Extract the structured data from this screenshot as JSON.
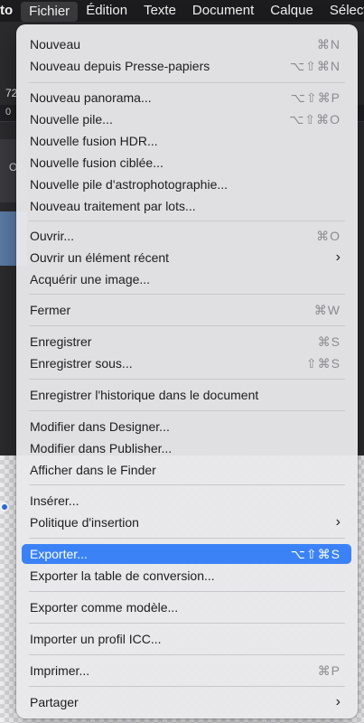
{
  "menubar": {
    "app": "to",
    "items": [
      "Fichier",
      "Édition",
      "Texte",
      "Document",
      "Calque",
      "Sélecti"
    ]
  },
  "background": {
    "toolbar_value": "72",
    "ruler_tick": "0",
    "panel_text": "O"
  },
  "menu": {
    "items": [
      {
        "label": "Nouveau",
        "shortcut": "⌘N"
      },
      {
        "label": "Nouveau depuis Presse-papiers",
        "shortcut": "⌥⇧⌘N"
      },
      {
        "label": "Nouveau panorama...",
        "shortcut": "⌥⇧⌘P"
      },
      {
        "label": "Nouvelle pile...",
        "shortcut": "⌥⇧⌘O"
      },
      {
        "label": "Nouvelle fusion HDR...",
        "shortcut": ""
      },
      {
        "label": "Nouvelle fusion ciblée...",
        "shortcut": ""
      },
      {
        "label": "Nouvelle pile d'astrophotographie...",
        "shortcut": ""
      },
      {
        "label": "Nouveau traitement par lots...",
        "shortcut": ""
      },
      {
        "label": "Ouvrir...",
        "shortcut": "⌘O"
      },
      {
        "label": "Ouvrir un élément récent",
        "shortcut": "",
        "submenu": "›"
      },
      {
        "label": "Acquérir une image...",
        "shortcut": ""
      },
      {
        "label": "Fermer",
        "shortcut": "⌘W"
      },
      {
        "label": "Enregistrer",
        "shortcut": "⌘S"
      },
      {
        "label": "Enregistrer sous...",
        "shortcut": "⇧⌘S"
      },
      {
        "label": "Enregistrer l'historique dans le document",
        "shortcut": ""
      },
      {
        "label": "Modifier dans Designer...",
        "shortcut": ""
      },
      {
        "label": "Modifier dans Publisher...",
        "shortcut": ""
      },
      {
        "label": "Afficher dans le Finder",
        "shortcut": ""
      },
      {
        "label": "Insérer...",
        "shortcut": ""
      },
      {
        "label": "Politique d'insertion",
        "shortcut": "",
        "submenu": "›"
      },
      {
        "label": "Exporter...",
        "shortcut": "⌥⇧⌘S",
        "selected": true
      },
      {
        "label": "Exporter la table de conversion...",
        "shortcut": ""
      },
      {
        "label": "Exporter comme modèle...",
        "shortcut": ""
      },
      {
        "label": "Importer un profil ICC...",
        "shortcut": ""
      },
      {
        "label": "Imprimer...",
        "shortcut": "⌘P"
      },
      {
        "label": "Partager",
        "shortcut": "",
        "submenu": "›"
      }
    ]
  }
}
